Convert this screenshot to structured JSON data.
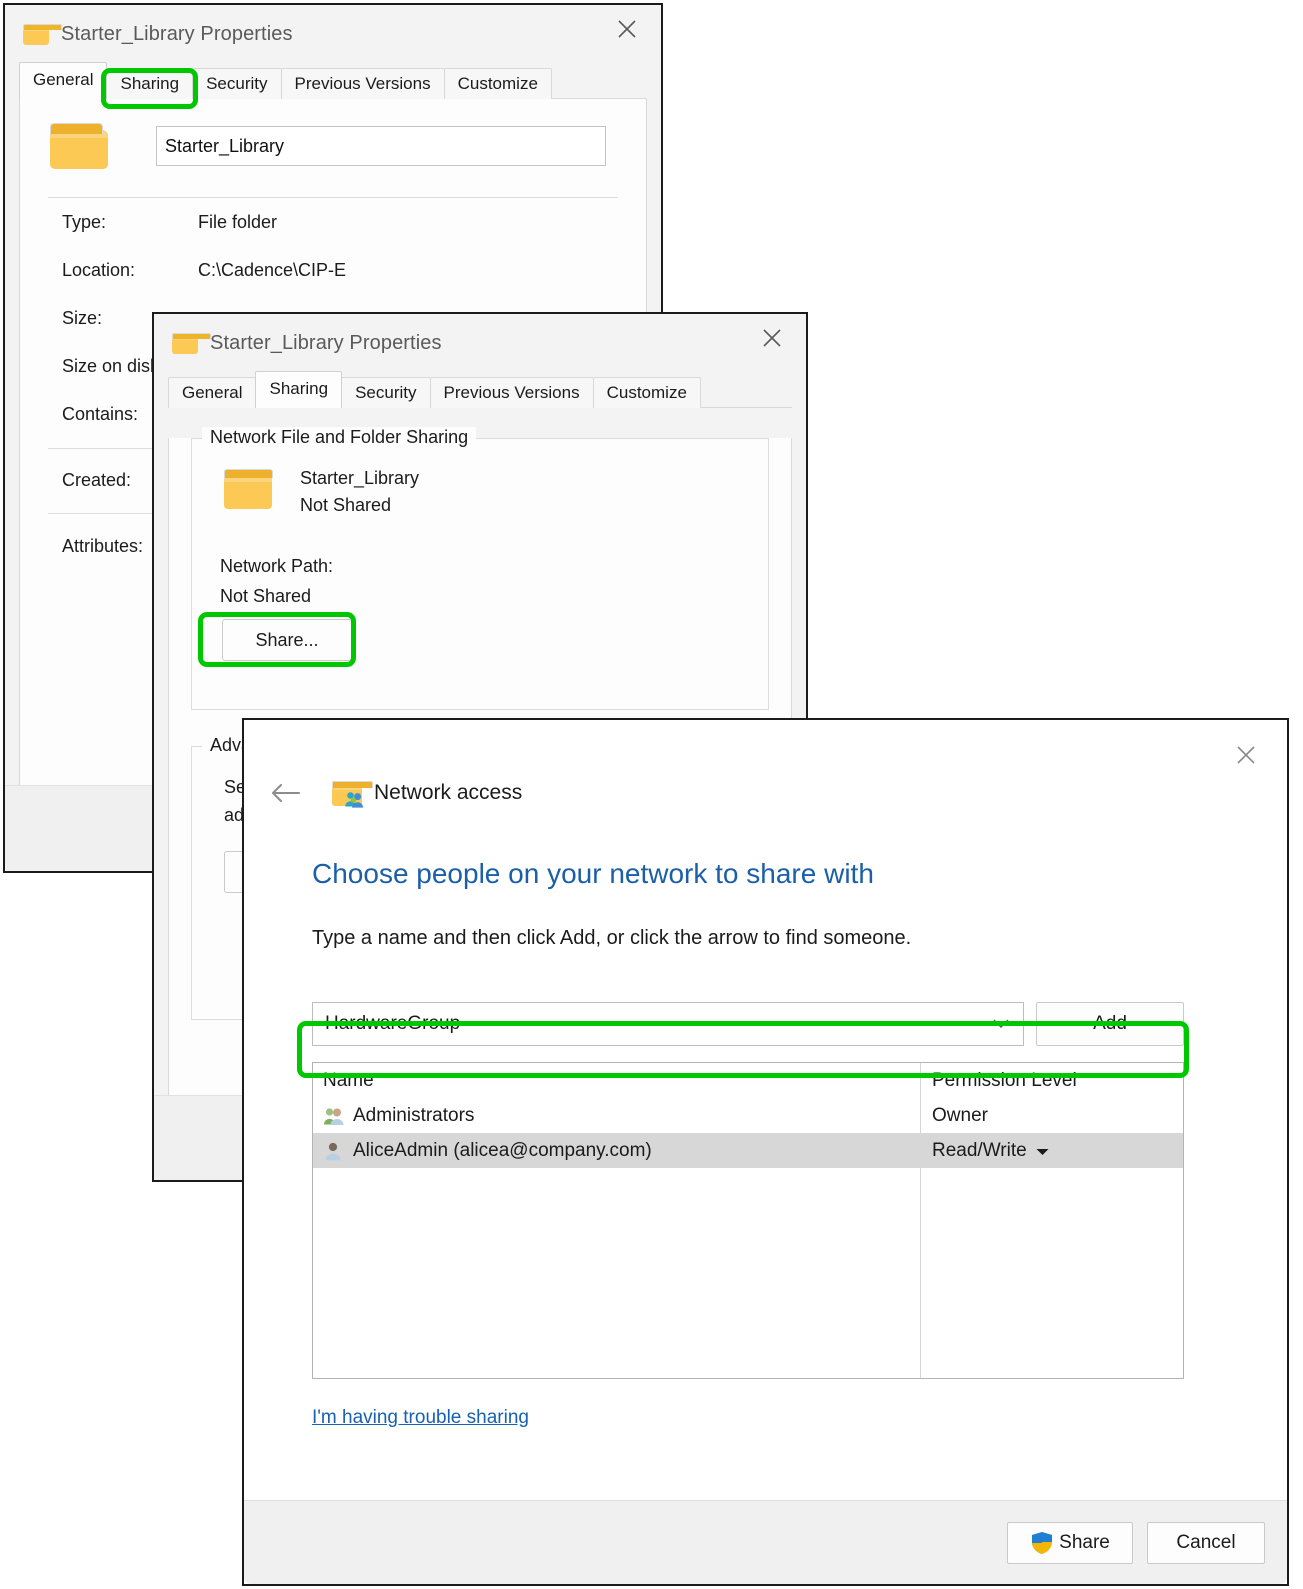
{
  "colors": {
    "highlight_green": "#00c800",
    "heading_blue": "#1b5fa8",
    "link_blue": "#1761b0",
    "selected_row": "#d7d7d7"
  },
  "dialog_general": {
    "title": "Starter_Library Properties",
    "title_icon": "folder-icon",
    "close_icon": "close-icon",
    "tabs": [
      {
        "label": "General",
        "active": true
      },
      {
        "label": "Sharing",
        "active": false
      },
      {
        "label": "Security",
        "active": false
      },
      {
        "label": "Previous Versions",
        "active": false
      },
      {
        "label": "Customize",
        "active": false
      }
    ],
    "folder_name_value": "Starter_Library",
    "properties": [
      {
        "key": "Type:",
        "value": "File folder"
      },
      {
        "key": "Location:",
        "value": "C:\\Cadence\\CIP-E"
      },
      {
        "key": "Size:",
        "value": ""
      },
      {
        "key": "Size on disk:",
        "value": ""
      },
      {
        "key": "Contains:",
        "value": ""
      },
      {
        "key": "Created:",
        "value": ""
      },
      {
        "key": "Attributes:",
        "value": ""
      }
    ]
  },
  "dialog_sharing": {
    "title": "Starter_Library Properties",
    "title_icon": "folder-icon",
    "close_icon": "close-icon",
    "tabs": [
      {
        "label": "General",
        "active": false
      },
      {
        "label": "Sharing",
        "active": true
      },
      {
        "label": "Security",
        "active": false
      },
      {
        "label": "Previous Versions",
        "active": false
      },
      {
        "label": "Customize",
        "active": false
      }
    ],
    "network_group": {
      "legend": "Network File and Folder Sharing",
      "folder_name": "Starter_Library",
      "share_status": "Not Shared",
      "network_path_label": "Network Path:",
      "network_path_value": "Not Shared",
      "share_button": "Share..."
    },
    "advanced_group": {
      "legend": "Advanced Sharing",
      "line1": "Set",
      "line2": "adv",
      "button": ""
    }
  },
  "dialog_network_access": {
    "close_icon": "close-icon",
    "back_icon": "back-arrow-icon",
    "header_icon": "folder-people-icon",
    "header_title": "Network access",
    "heading": "Choose people on your network to share with",
    "subtitle": "Type a name and then click Add, or click the arrow to find someone.",
    "combo": {
      "value": "HardwareGroup",
      "placeholder": "",
      "chevron_icon": "chevron-down-icon"
    },
    "add_button": "Add",
    "table": {
      "columns": [
        "Name",
        "Permission Level"
      ],
      "rows": [
        {
          "icon": "users-group-icon",
          "name": "Administrators",
          "permission": "Owner",
          "has_caret": false,
          "selected": false
        },
        {
          "icon": "user-icon",
          "name": "AliceAdmin (alicea@company.com)",
          "permission": "Read/Write",
          "has_caret": true,
          "selected": true
        }
      ]
    },
    "trouble_link": "I'm having trouble sharing",
    "share_button": "Share",
    "share_button_icon": "uac-shield-icon",
    "cancel_button": "Cancel"
  },
  "annotations": [
    {
      "name": "highlight-sharing-tab"
    },
    {
      "name": "highlight-share-button"
    },
    {
      "name": "highlight-name-combobox"
    }
  ]
}
